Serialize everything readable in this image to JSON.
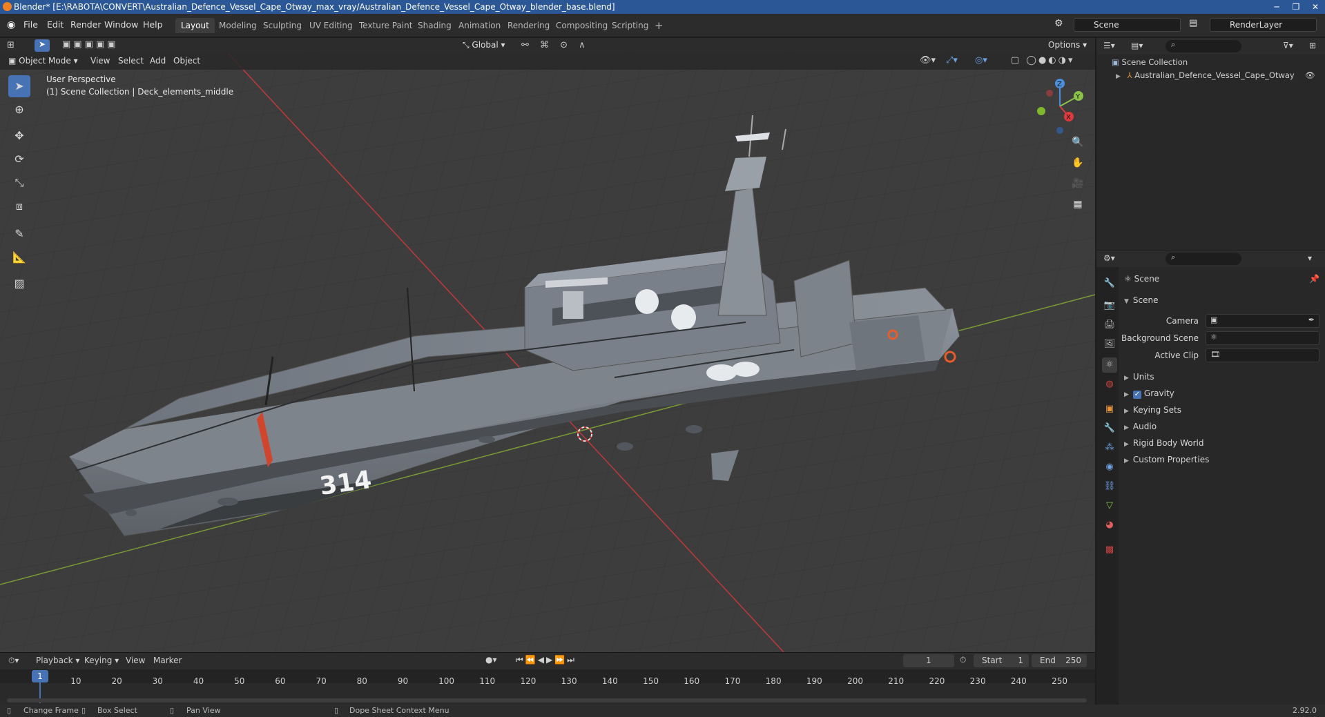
{
  "window": {
    "title": "Blender* [E:\\RABOTA\\CONVERT\\Australian_Defence_Vessel_Cape_Otway_max_vray/Australian_Defence_Vessel_Cape_Otway_blender_base.blend]"
  },
  "menu": {
    "file": "File",
    "edit": "Edit",
    "render": "Render",
    "window": "Window",
    "help": "Help"
  },
  "workspaces": [
    "Layout",
    "Modeling",
    "Sculpting",
    "UV Editing",
    "Texture Paint",
    "Shading",
    "Animation",
    "Rendering",
    "Compositing",
    "Scripting"
  ],
  "top_right": {
    "scene": "Scene",
    "render_layer": "RenderLayer"
  },
  "toolbar": {
    "orientation": "Global",
    "options": "Options"
  },
  "viewport_header": {
    "mode": "Object Mode",
    "view": "View",
    "select": "Select",
    "add": "Add",
    "object": "Object"
  },
  "viewport": {
    "perspective": "User Perspective",
    "collection_info": "(1) Scene Collection | Deck_elements_middle",
    "hull_number": "314",
    "gizmo": {
      "x": "X",
      "y": "Y",
      "z": "Z"
    }
  },
  "outliner": {
    "root": "Scene Collection",
    "items": [
      {
        "label": "Australian_Defence_Vessel_Cape_Otway"
      }
    ]
  },
  "properties": {
    "header": "Scene",
    "section": "Scene",
    "fields": {
      "camera": "Camera",
      "background_scene": "Background Scene",
      "active_clip": "Active Clip"
    },
    "panels": [
      "Units",
      "Gravity",
      "Keying Sets",
      "Audio",
      "Rigid Body World",
      "Custom Properties"
    ],
    "gravity_checked": true
  },
  "timeline": {
    "playback": "Playback",
    "keying": "Keying",
    "view": "View",
    "marker": "Marker",
    "current_frame": "1",
    "start_label": "Start",
    "start": "1",
    "end_label": "End",
    "end": "250",
    "ticks": [
      "1",
      "10",
      "20",
      "30",
      "40",
      "50",
      "60",
      "70",
      "80",
      "90",
      "100",
      "110",
      "120",
      "130",
      "140",
      "150",
      "160",
      "170",
      "180",
      "190",
      "200",
      "210",
      "220",
      "230",
      "240",
      "250"
    ]
  },
  "statusbar": {
    "change_frame": "Change Frame",
    "box_select": "Box Select",
    "pan_view": "Pan View",
    "context_menu": "Dope Sheet Context Menu",
    "version": "2.92.0"
  },
  "colors": {
    "accent": "#4772b3",
    "titlebar": "#2b5797",
    "x_axis": "#e0393e",
    "y_axis": "#8bc34a",
    "z_axis": "#4a8fe0"
  }
}
